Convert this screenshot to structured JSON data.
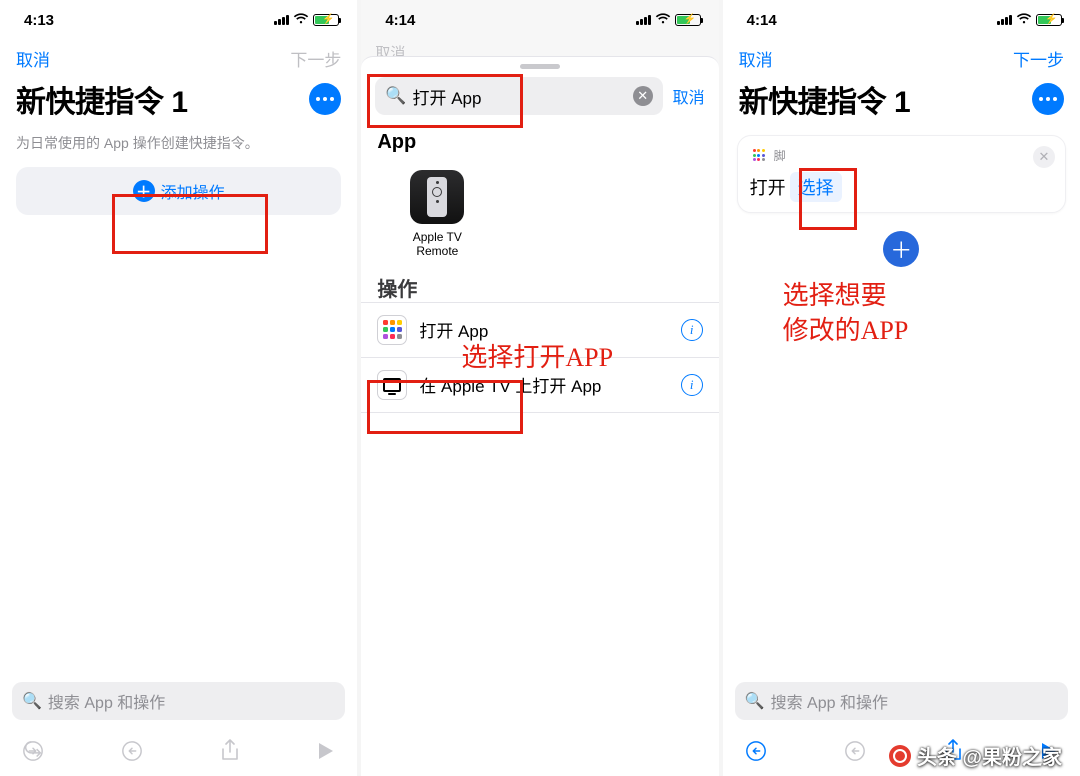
{
  "colors": {
    "accent": "#007aff",
    "annotation": "#e21f12",
    "battery": "#34c759"
  },
  "watermark": "头条 @果粉之家",
  "pane1": {
    "status_time": "4:13",
    "nav_cancel": "取消",
    "nav_next": "下一步",
    "title": "新快捷指令 1",
    "subtitle": "为日常使用的 App 操作创建快捷指令。",
    "add_action": "添加操作",
    "search_placeholder": "搜索 App 和操作"
  },
  "pane2": {
    "status_time": "4:14",
    "dim_cancel": "取消",
    "search_value": "打开 App",
    "search_cancel": "取消",
    "section_app": "App",
    "app_card_label": "Apple TV Remote",
    "section_ops": "操作",
    "row_open_app": "打开 App",
    "row_open_on_tv": "在 Apple TV 上打开 App",
    "annotation": "选择打开APP"
  },
  "pane3": {
    "status_time": "4:14",
    "nav_cancel": "取消",
    "nav_next": "下一步",
    "title": "新快捷指令 1",
    "card_head": "脚",
    "card_open_label": "打开",
    "card_token": "选择",
    "annotation": "选择想要\n修改的APP",
    "search_placeholder": "搜索 App 和操作"
  }
}
